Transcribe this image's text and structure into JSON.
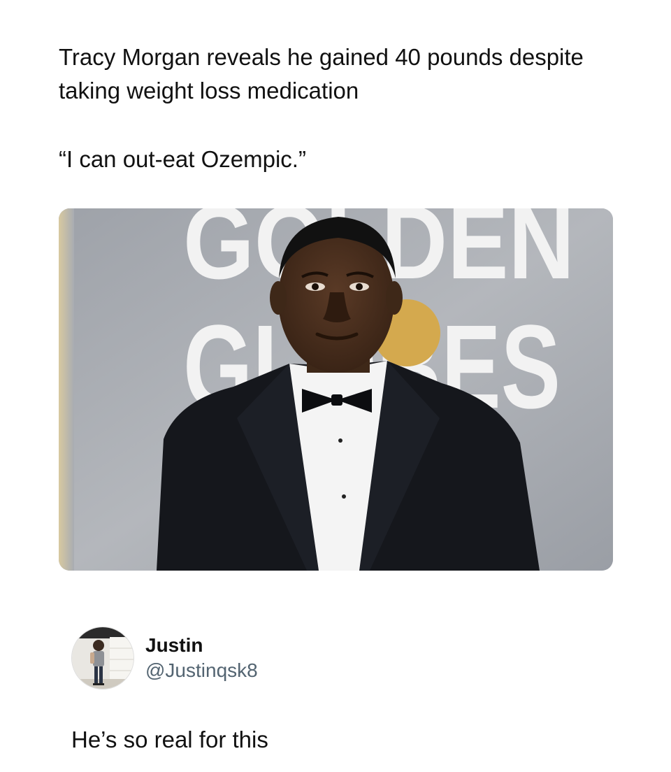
{
  "post": {
    "headline": "Tracy Morgan reveals he gained 40 pounds despite taking weight loss medication",
    "quote": "“I can out-eat Ozempic.”"
  },
  "photo": {
    "backdrop_text": [
      "GOLDEN",
      "GLOBES"
    ]
  },
  "reply": {
    "author_name": "Justin",
    "author_handle": "@Justinqsk8",
    "text": "He’s so real for this"
  },
  "colors": {
    "background": "#ffffff",
    "text": "#111111",
    "handle": "#536471",
    "backdrop": "#a8acb2",
    "gold_accent": "#d4a94e"
  }
}
